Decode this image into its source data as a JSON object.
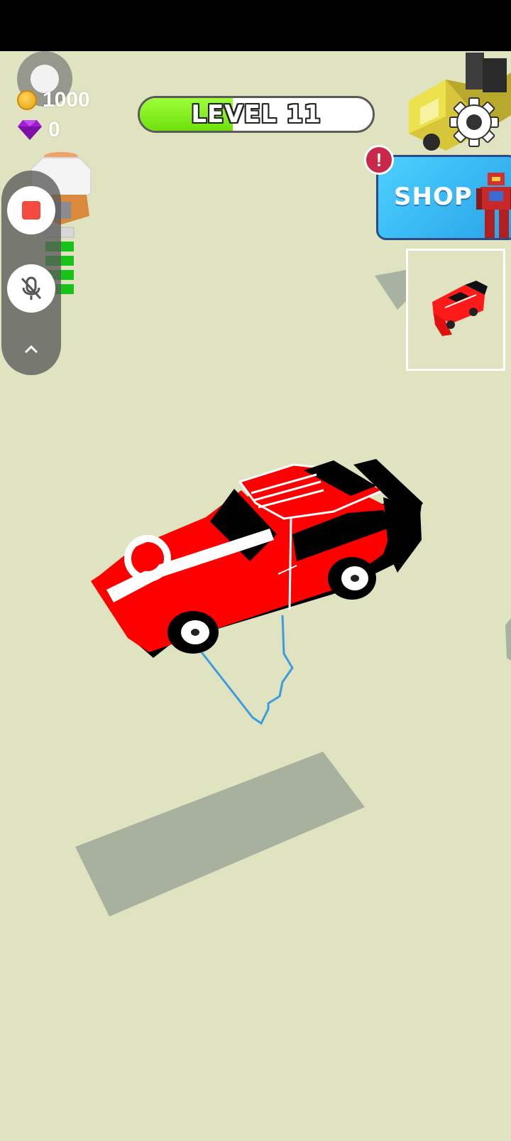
{
  "hud": {
    "level_label": "LEVEL 11",
    "level_progress": 0.4,
    "coins": "1000",
    "gems": "0",
    "shop_label": "SHOP",
    "alert_symbol": "!"
  },
  "icons": {
    "coin": "coin-icon",
    "gem": "gem-icon",
    "settings": "gear-icon",
    "record_stop": "stop-icon",
    "mic_off": "mic-off-icon",
    "collapse": "chevron-up-icon"
  },
  "colors": {
    "ground": "#dfe3bf",
    "level_fill": "#7fee1a",
    "car_body": "#ff0000",
    "shop_bg": "#3bbcf4",
    "alert_badge": "#c8284a",
    "drawn_line": "#3d9be0"
  }
}
